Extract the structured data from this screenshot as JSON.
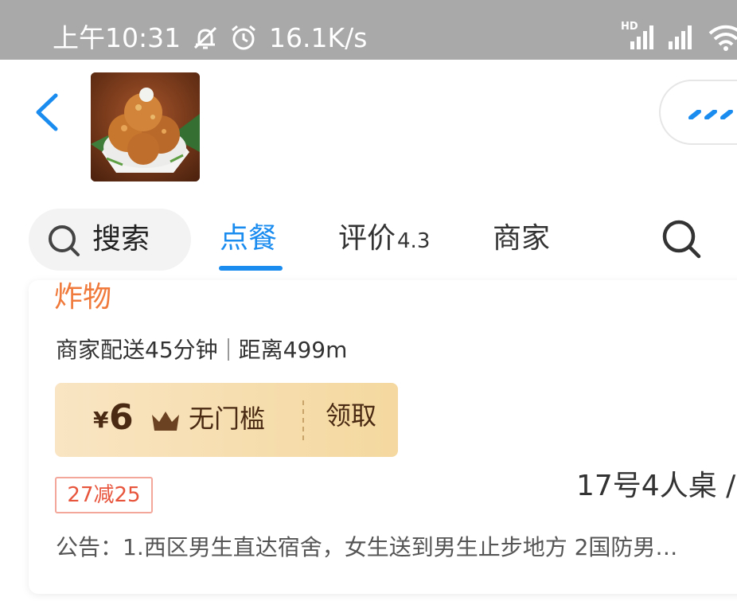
{
  "status_bar": {
    "time": "上午10:31",
    "network_speed": "16.1K/s",
    "hd_label": "HD",
    "icons": [
      "mute-bell-icon",
      "alarm-clock-icon",
      "hd-signal-icon",
      "signal-icon",
      "wifi-icon"
    ]
  },
  "header": {
    "back_icon": "chevron-left-icon",
    "store_logo": "fried-food-dish-photo",
    "more_icon": "ellipsis-icon"
  },
  "tabs": {
    "search_label": "搜索",
    "items": [
      {
        "label": "点餐",
        "active": true
      },
      {
        "label": "评价",
        "score": "4.3",
        "active": false
      },
      {
        "label": "商家",
        "active": false
      }
    ],
    "search_icon": "search-icon"
  },
  "store_card": {
    "category": "炸物",
    "delivery": "商家配送45分钟",
    "distance": "距离499m",
    "coupon": {
      "currency": "¥",
      "amount": "6",
      "condition": "无门槛",
      "action": "领取"
    },
    "promo": "27减25",
    "table": "17号4人桌 /",
    "announcement": "公告：1.西区男生直达宿舍，女生送到男生止步地方 2国防男…"
  },
  "colors": {
    "accent": "#1a8cf0",
    "category": "#f07a3b",
    "promo": "#e8553d",
    "coupon_bg": "#f4d89f",
    "status_bar": "#a9a9a9"
  }
}
